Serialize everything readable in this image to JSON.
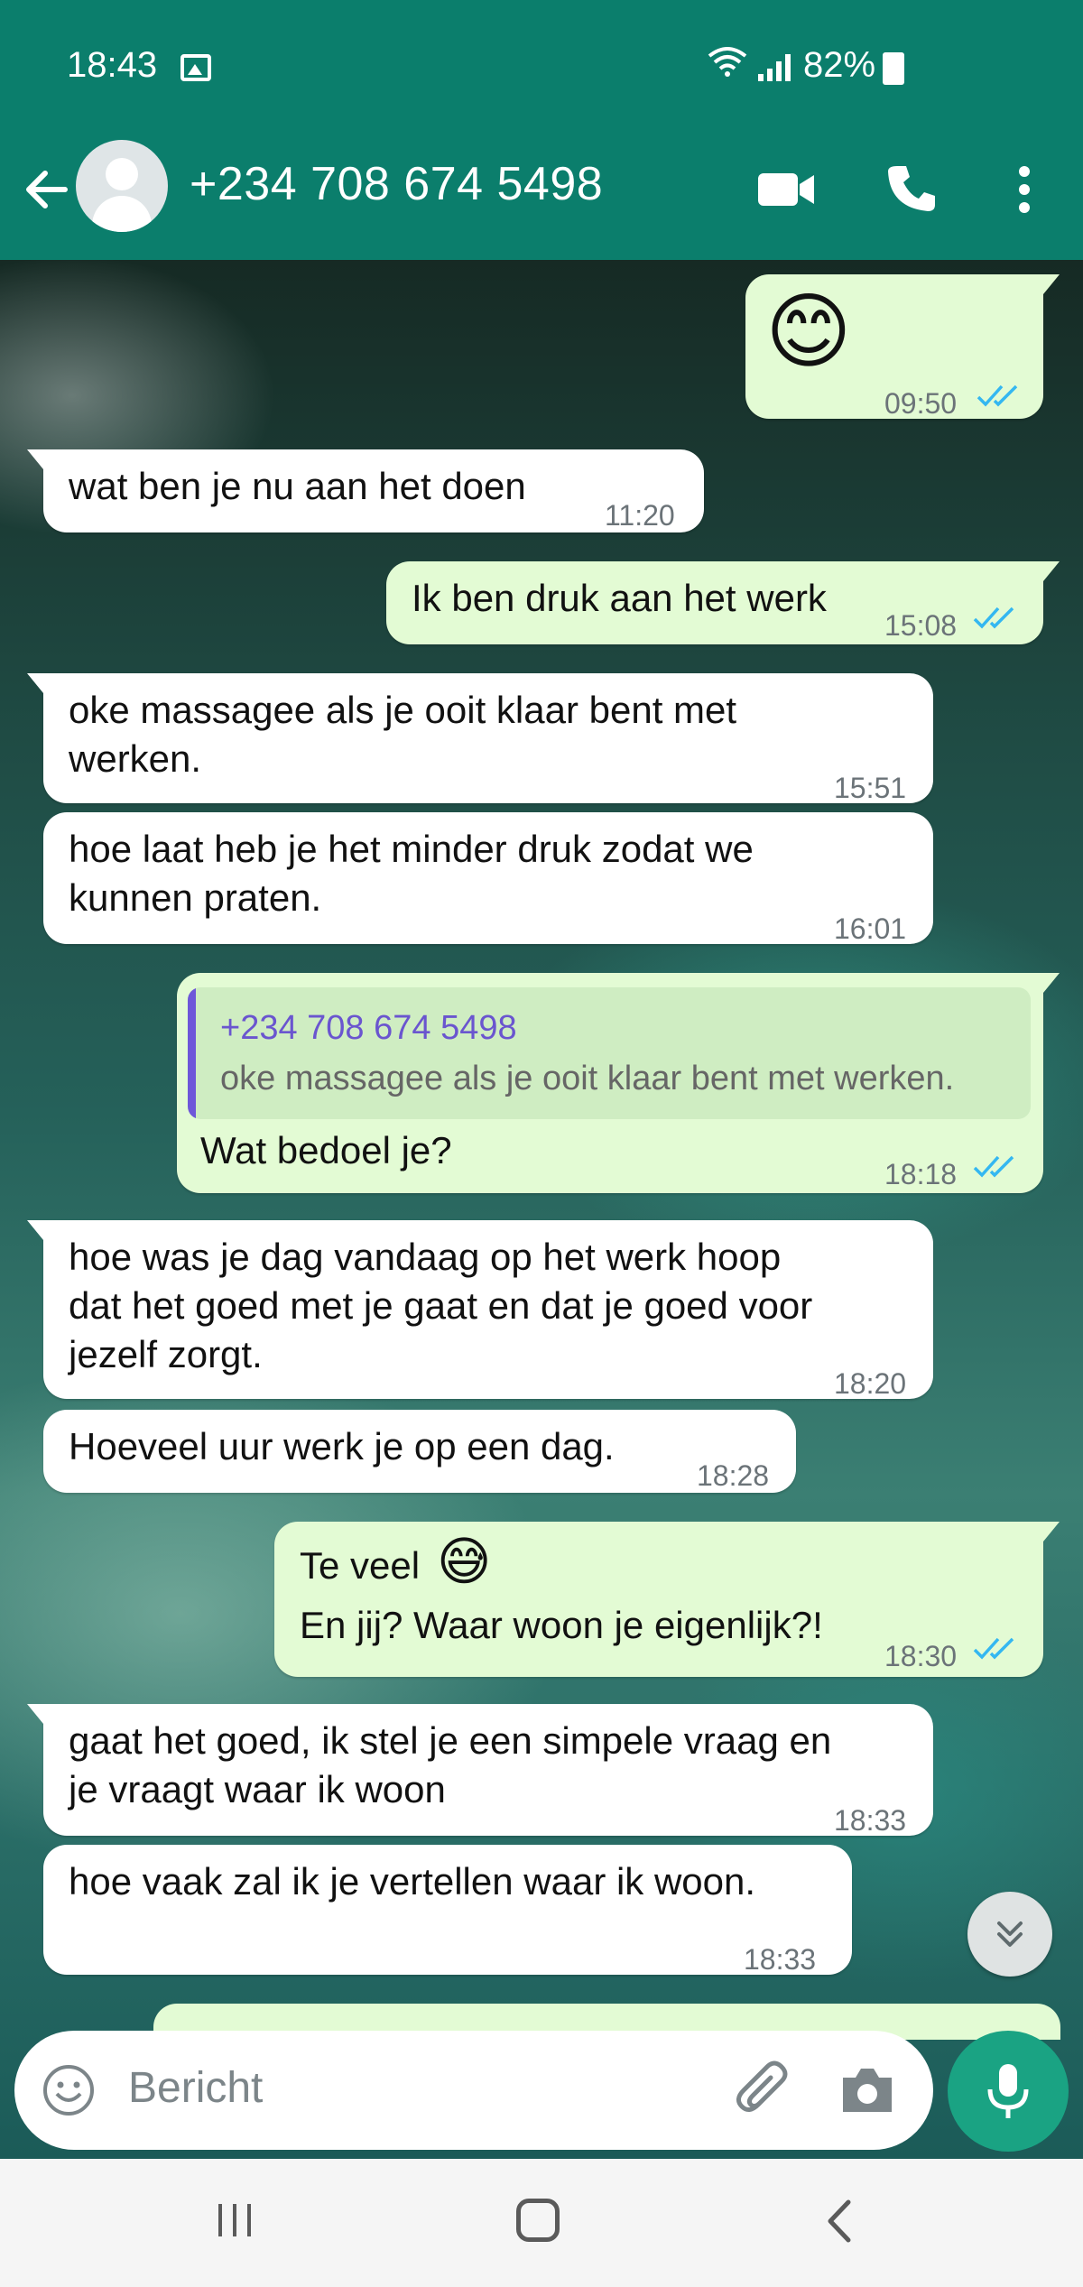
{
  "status_bar": {
    "time": "18:43",
    "battery": "82%",
    "icons": [
      "image-icon",
      "wifi-icon",
      "signal-icon",
      "battery-icon"
    ]
  },
  "header": {
    "contact_name": "+234 708 674 5498",
    "icons": [
      "back-arrow-icon",
      "default-avatar-icon",
      "video-call-icon",
      "phone-call-icon",
      "more-options-icon"
    ],
    "background_color": "#0b7e6c"
  },
  "messages": [
    {
      "direction": "outgoing",
      "text": "😊",
      "time": "09:50",
      "read": true
    },
    {
      "direction": "incoming",
      "text": "wat ben je nu aan het doen",
      "time": "11:20"
    },
    {
      "direction": "outgoing",
      "text": "Ik ben druk aan het werk",
      "time": "15:08",
      "read": true
    },
    {
      "direction": "incoming",
      "text": "oke massagee als je ooit klaar bent met\nwerken.",
      "time": "15:51"
    },
    {
      "direction": "incoming",
      "text": "hoe laat heb je het minder druk zodat we\nkunnen praten.",
      "time": "16:01"
    },
    {
      "direction": "outgoing",
      "quoted_name": "+234 708 674 5498",
      "quoted_text": "oke massagee als je ooit klaar bent met werken.",
      "text": "Wat bedoel je?",
      "time": "18:18",
      "read": true
    },
    {
      "direction": "incoming",
      "text": "hoe was je dag vandaag op het werk hoop\ndat het goed met je gaat en dat je goed voor\njezelf zorgt.",
      "time": "18:20"
    },
    {
      "direction": "incoming",
      "text": "Hoeveel uur werk je op een dag.",
      "time": "18:28"
    },
    {
      "direction": "outgoing",
      "text_line1": "Te veel",
      "emoji": "😅",
      "text_line2": "En jij? Waar woon je eigenlijk?!",
      "time": "18:30",
      "read": true
    },
    {
      "direction": "incoming",
      "text": "gaat het goed, ik stel je een simpele vraag en\nje vraagt waar ik woon",
      "time": "18:33"
    },
    {
      "direction": "incoming",
      "text": "hoe vaak zal ik je vertellen waar ik woon.",
      "time": "18:33"
    }
  ],
  "composer": {
    "placeholder": "Bericht",
    "icons": [
      "emoji-icon",
      "attach-icon",
      "camera-icon",
      "mic-icon"
    ],
    "mic_color": "#1aa383"
  },
  "colors": {
    "incoming_bubble": "#ffffff",
    "outgoing_bubble": "#e3fbd4",
    "read_ticks": "#34b7f1",
    "quote_name": "#6a55cf"
  }
}
